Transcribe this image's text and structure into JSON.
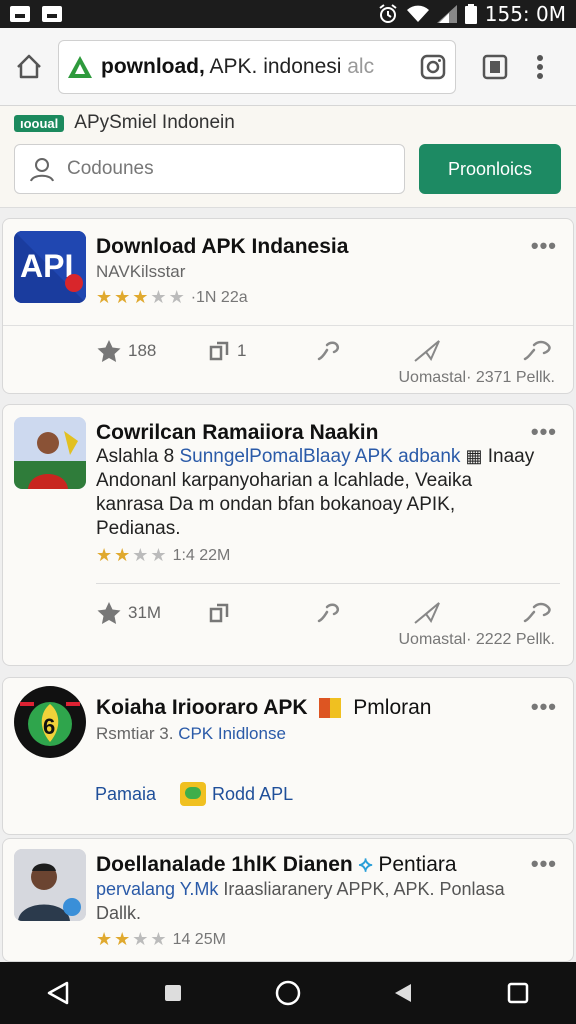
{
  "status": {
    "time": "155: 0M"
  },
  "browser": {
    "url_bold": "pownload,",
    "url_rest": " APK. indonesi",
    "url_faded": " alc"
  },
  "header": {
    "badge": "ıooual",
    "brand": "APySmiel Indonein",
    "search_placeholder": "Codounes",
    "promo_button": "Proonloics"
  },
  "cards": [
    {
      "title": "Download APK Indanesia",
      "subtitle": "NAVKilsstar",
      "rating_text": "·1N 22a",
      "stars": 3,
      "likes": "188",
      "shares": "1",
      "footer": "Uomastal· 2371 Pellk."
    },
    {
      "title": "Cowrilcan Ramaiiora Naakin",
      "desc_a": "Aslahla 8 ",
      "desc_blue": "SunngelPomalBlaay APK adbank",
      "desc_b": " Inaay Andonanl karpanyoharian a lcahlade, Veaika kanrasa Da m ondan bfan bokanoay APIK, Pedianas.",
      "rating_text": "1:4 22M",
      "stars": 2,
      "likes": "31M",
      "footer": "Uomastal· 2222 Pellk."
    },
    {
      "title": "Koiaha Iriooraro APK",
      "title_tail": "Pmloran",
      "sub_a": "Rsmtiar 3. ",
      "sub_blue": "CPK Inidlonse",
      "link_a": "Pamaia",
      "link_b": "Rodd APL"
    },
    {
      "title": "Doellanalade 1hlK Dianen",
      "title_tail": "Pentiara",
      "sub_blue": "pervalang Y.Mk",
      "sub_rest": " Iraasliaranery APPK, APK. Ponlasa Dallk.",
      "rating_text": "14 25M",
      "stars": 2
    }
  ]
}
